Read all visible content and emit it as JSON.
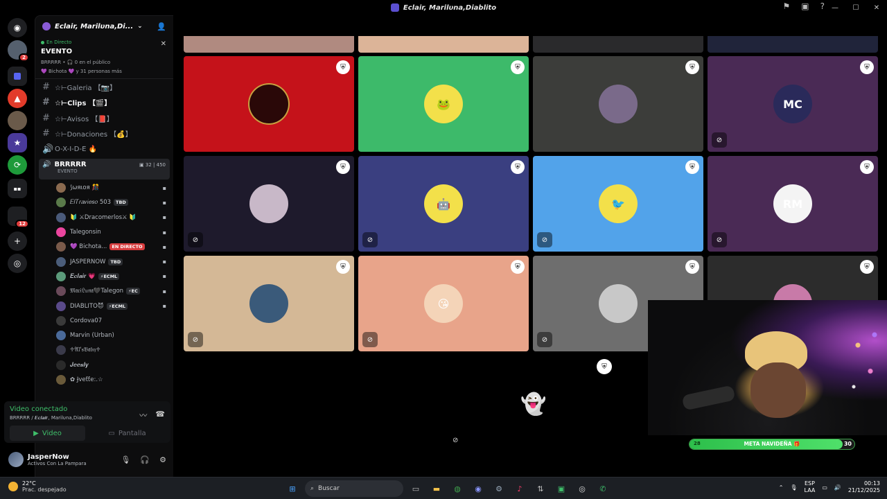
{
  "window": {
    "title": "Eclair, Marilυna,Diablito"
  },
  "rail": {
    "dm_badge": "2",
    "server_badge": "12"
  },
  "server": {
    "name": "Eclair, Marilυna,Di..."
  },
  "event": {
    "status": "En Directo",
    "title": "EVENTO",
    "meta": "BRRRRR • 🎧 0 en el público",
    "people": "💜 Bichota 💜 y 31 personas más"
  },
  "channels": [
    {
      "name": "☆⊢Galeria 【📷】",
      "type": "text",
      "bold": false
    },
    {
      "name": "☆⊢Clips 【🎬】",
      "type": "text",
      "bold": true
    },
    {
      "name": "☆⊢Avisos 【📕】",
      "type": "text",
      "bold": false
    },
    {
      "name": "☆⊢Donaciones 【💰】",
      "type": "text",
      "bold": false
    },
    {
      "name": "O-X-I-D-E 🔥",
      "type": "voice",
      "bold": false
    }
  ],
  "voice_channel": {
    "name": "BRRRRR",
    "sub": "EVENTO",
    "cams": "32",
    "listeners": "450"
  },
  "members": [
    {
      "name": "⟆ωяιoя 🎊",
      "tag": "",
      "color": "#8b6a4f"
    },
    {
      "name": "𝐸𝑙𝑇𝑟𝑎𝑣𝑖𝑒𝑠𝑜 503",
      "tag": "TBD",
      "color": "#5a7a4a"
    },
    {
      "name": "🔰 ⚔Dracomerlos⚔ 🔰",
      "tag": "",
      "color": "#4a5a7a"
    },
    {
      "name": "Talegonsin",
      "tag": "",
      "color": "#eb459e"
    },
    {
      "name": "💜 Bichota...",
      "tag": "EN DIRECTO",
      "color": "#7a5a4a"
    },
    {
      "name": "JASPERNOW",
      "tag": "TBD",
      "color": "#4b5d7a"
    },
    {
      "name": "𝑬𝒄𝒍𝒂𝒊𝒓 💗",
      "tag": "⚡ECML",
      "color": "#5b9a7a"
    },
    {
      "name": "𝔐𝔞𝔯𝔦𝔏𝔲𝔫𝔞🖤Talegon",
      "tag": "⚡EC",
      "color": "#6a4a5a"
    },
    {
      "name": "DIABLITO😈",
      "tag": "⚡ECML",
      "color": "#5a4a8a"
    },
    {
      "name": "Cordova07",
      "tag": "",
      "color": "#3a3a3a"
    },
    {
      "name": "Marvin (Urban)",
      "tag": "",
      "color": "#4a6a9a"
    },
    {
      "name": "♱𝔄𝔩'𝔰𝔅𝔞𝔟𝔶♱",
      "tag": "",
      "color": "#3a3a4a"
    },
    {
      "name": "𝑱𝒆𝒆𝒔𝒍𝒚",
      "tag": "",
      "color": "#2a2a2a"
    },
    {
      "name": "✿ Ɉveƭƭe:.☆",
      "tag": "",
      "color": "#6a5a3a"
    }
  ],
  "voice_panel": {
    "status": "Video conectado",
    "channel": "BRRRRR / 𝑬𝒄𝒍𝒂𝒊𝒓, Marilυna,Diablito",
    "video_label": "Video",
    "screen_label": "Pantalla"
  },
  "user": {
    "name": "JasperNow",
    "status": "Activos Con La Pampara"
  },
  "tiles": [
    {
      "bg": "#b08a80",
      "pfp": "",
      "pfp_bg": "transparent",
      "partial": true
    },
    {
      "bg": "#dcb498",
      "pfp": "",
      "pfp_bg": "transparent",
      "partial": true
    },
    {
      "bg": "#2a2a2c",
      "pfp": "",
      "pfp_bg": "transparent",
      "partial": true
    },
    {
      "bg": "#20243a",
      "pfp": "",
      "pfp_bg": "transparent",
      "partial": true
    },
    {
      "bg": "#c5121a",
      "pfp": "",
      "pfp_bg": "#2a0808",
      "mute": false
    },
    {
      "bg": "#3dba6a",
      "pfp": "🐸",
      "pfp_bg": "#f3e04a",
      "mute": false
    },
    {
      "bg": "#3c3d3a",
      "pfp": "",
      "pfp_bg": "#7a6a8a",
      "mute": false
    },
    {
      "bg": "#4a2a55",
      "pfp": "MC",
      "pfp_bg": "#2a2a5a",
      "mute": true
    },
    {
      "bg": "#1e1a2c",
      "pfp": "",
      "pfp_bg": "#c8b8c8",
      "mute": true
    },
    {
      "bg": "#3a3f80",
      "pfp": "🤖",
      "pfp_bg": "#f3e04a",
      "mute": true
    },
    {
      "bg": "#52a3ea",
      "pfp": "🐦",
      "pfp_bg": "#f3e04a",
      "mute": true
    },
    {
      "bg": "#4a2a55",
      "pfp": "RM",
      "pfp_bg": "#f4f4f4",
      "mute": true
    },
    {
      "bg": "#d4b896",
      "pfp": "",
      "pfp_bg": "#3a5a7a",
      "mute": true
    },
    {
      "bg": "#e8a48a",
      "pfp": "😘",
      "pfp_bg": "#f4d4b8",
      "mute": true
    },
    {
      "bg": "#6e6e6e",
      "pfp": "",
      "pfp_bg": "#c8c8c8",
      "mute": true
    },
    {
      "bg": "#2c2c2c",
      "pfp": "",
      "pfp_bg": "#c87aa8",
      "mute": false
    }
  ],
  "goal": {
    "start": "28",
    "label": "META NAVIDEÑA 🎁",
    "end": "30",
    "progress": 0.93
  },
  "taskbar": {
    "temp": "22°C",
    "weather": "Prac. despejado",
    "search": "Buscar",
    "lang1": "ESP",
    "lang2": "LAA",
    "time": "00:13",
    "date": "21/12/2025"
  }
}
